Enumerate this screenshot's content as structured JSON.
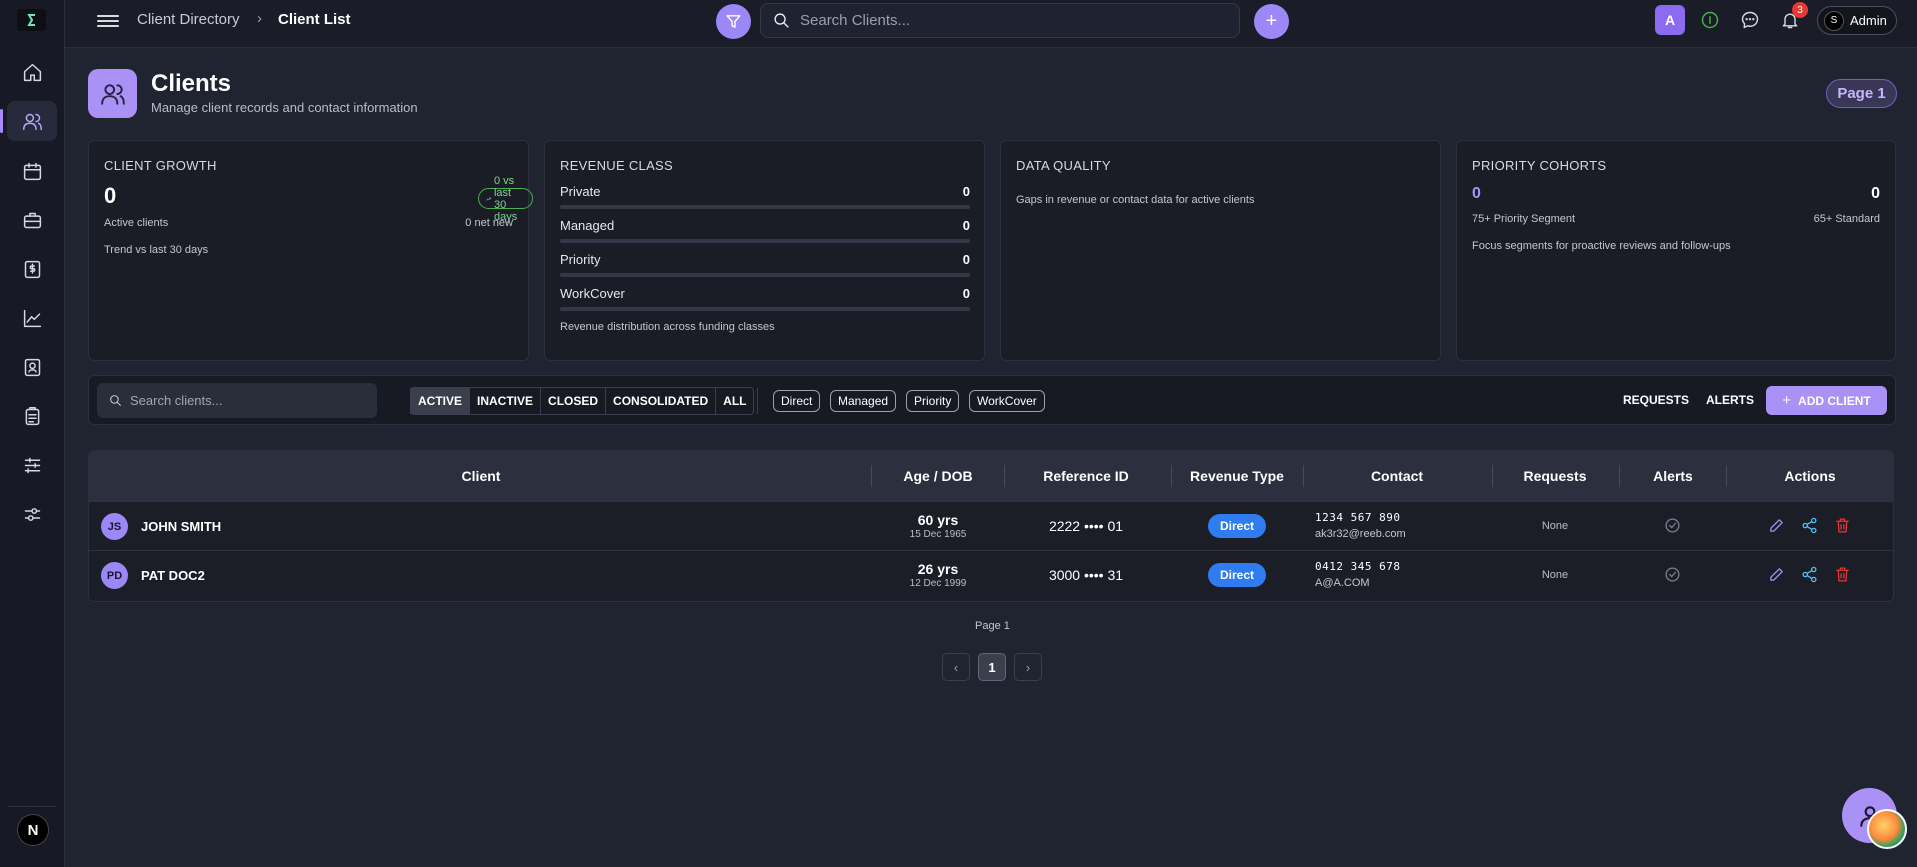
{
  "topbar": {
    "breadcrumb_1": "Client Directory",
    "breadcrumb_sep": "›",
    "breadcrumb_2": "Client List",
    "search_placeholder": "Search Clients...",
    "add_label": "+",
    "user_initial": "A",
    "notification_count": "3",
    "admin_label": "Admin",
    "admin_logo": "S"
  },
  "sidebar": {
    "logo": "S",
    "items": [
      {
        "icon": "home-icon"
      },
      {
        "icon": "users-icon",
        "active": true
      },
      {
        "icon": "calendar-icon"
      },
      {
        "icon": "briefcase-icon"
      },
      {
        "icon": "dollar-icon"
      },
      {
        "icon": "chart-line-icon"
      },
      {
        "icon": "contact-card-icon"
      },
      {
        "icon": "clipboard-icon"
      },
      {
        "icon": "sliders-icon"
      },
      {
        "icon": "settings-sliders-icon"
      }
    ],
    "bottom_avatar": "N"
  },
  "header": {
    "title": "Clients",
    "subtitle": "Manage client records and contact information",
    "page_pill": "Page 1"
  },
  "cards": {
    "growth": {
      "title": "CLIENT GROWTH",
      "value": "0",
      "trend": "0 vs last 30 days",
      "label": "Active clients",
      "net_new": "0 net new",
      "note": "Trend vs last 30 days"
    },
    "revenue": {
      "title": "REVENUE CLASS",
      "rows": [
        {
          "label": "Private",
          "value": "0"
        },
        {
          "label": "Managed",
          "value": "0"
        },
        {
          "label": "Priority",
          "value": "0"
        },
        {
          "label": "WorkCover",
          "value": "0"
        }
      ],
      "note": "Revenue distribution across funding classes"
    },
    "quality": {
      "title": "DATA QUALITY",
      "note": "Gaps in revenue or contact data for active clients"
    },
    "cohorts": {
      "title": "PRIORITY COHORTS",
      "left_value": "0",
      "right_value": "0",
      "left_label": "75+ Priority Segment",
      "right_label": "65+ Standard",
      "note": "Focus segments for proactive reviews and follow-ups"
    }
  },
  "filters": {
    "search_placeholder": "Search clients...",
    "statuses": [
      "ACTIVE",
      "INACTIVE",
      "CLOSED",
      "CONSOLIDATED",
      "ALL"
    ],
    "active_status": "ACTIVE",
    "chips": [
      "Direct",
      "Managed",
      "Priority",
      "WorkCover"
    ],
    "requests_label": "REQUESTS",
    "alerts_label": "ALERTS",
    "add_client_label": "ADD CLIENT"
  },
  "table": {
    "columns": [
      "Client",
      "Age / DOB",
      "Reference ID",
      "Revenue Type",
      "Contact",
      "Requests",
      "Alerts",
      "Actions"
    ],
    "rows": [
      {
        "initials": "JS",
        "name": "JOHN SMITH",
        "age": "60 yrs",
        "dob": "15 Dec 1965",
        "ref": "2222 •••• 01",
        "revenue": "Direct",
        "phone": "1234 567 890",
        "email": "ak3r32@reeb.com",
        "requests": "None"
      },
      {
        "initials": "PD",
        "name": "PAT DOC2",
        "age": "26 yrs",
        "dob": "12 Dec 1999",
        "ref": "3000 •••• 31",
        "revenue": "Direct",
        "phone": "0412 345 678",
        "email": "A@A.COM",
        "requests": "None"
      }
    ]
  },
  "pagination": {
    "label": "Page 1",
    "current": "1",
    "prev": "‹",
    "next": "›"
  },
  "colors": {
    "accent": "#a991f6",
    "badge_blue": "#2f7cf0",
    "delete_red": "#e53935",
    "share_blue": "#4fc3f7"
  }
}
